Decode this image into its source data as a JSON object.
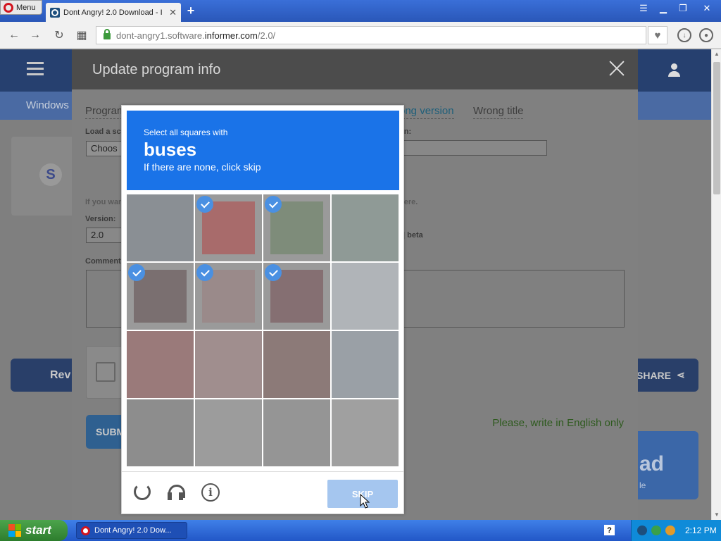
{
  "browser": {
    "menu_label": "Menu",
    "tab_title": "Dont Angry! 2.0 Download - I",
    "tab_close": "✕",
    "new_tab": "+",
    "url_prefix": "dont-angry1.software.",
    "url_host": "informer.com",
    "url_path": "/2.0/"
  },
  "page": {
    "category_link": "Windows",
    "review_button": "Rev",
    "share_button": "SHARE",
    "download_big": "ad",
    "download_small": "le"
  },
  "modal": {
    "title": "Update program info",
    "tabs": [
      "Program",
      "ong version",
      "Wrong title"
    ],
    "load_screenshot_label": "Load a scr",
    "file_button": "Choos",
    "version_field_label": "on:",
    "hint_left": "If you war",
    "hint_right": "here.",
    "version_label": "Version:",
    "version_value": "2.0",
    "beta_label": "beta",
    "comment_label": "Comment",
    "submit_label": "SUBM",
    "english_notice": "Please, write in English only"
  },
  "captcha": {
    "instruction": "Select all squares with",
    "target": "buses",
    "fallback": "If there are none, click skip",
    "cells": [
      {
        "selected": false
      },
      {
        "selected": true
      },
      {
        "selected": true
      },
      {
        "selected": false
      },
      {
        "selected": true
      },
      {
        "selected": true
      },
      {
        "selected": true
      },
      {
        "selected": false
      },
      {
        "selected": false
      },
      {
        "selected": false
      },
      {
        "selected": false
      },
      {
        "selected": false
      },
      {
        "selected": false
      },
      {
        "selected": false
      },
      {
        "selected": false
      },
      {
        "selected": false
      }
    ],
    "skip_label": "SKIP",
    "reload_icon": "reload-icon",
    "audio_icon": "headphones-icon",
    "info_icon": "info-icon",
    "info_glyph": "i",
    "accent_color": "#1a73e8"
  },
  "taskbar": {
    "start_label": "start",
    "task_item": "Dont Angry! 2.0 Dow...",
    "help_glyph": "?",
    "clock": "2:12 PM"
  }
}
